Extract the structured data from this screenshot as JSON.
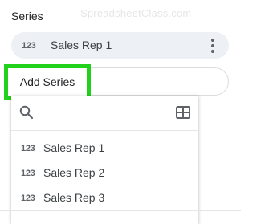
{
  "panel": {
    "section_title": "Series",
    "watermark": "SpreadsheetClass.com"
  },
  "series_chip": {
    "icon": "123-number-icon",
    "icon_text": "123",
    "label": "Sales Rep 1",
    "menu_icon": "more-vert-icon"
  },
  "add_series": {
    "label": "Add Series",
    "highlight_color": "#22d11b"
  },
  "dropdown": {
    "search_icon": "search-icon",
    "grid_icon": "grid-select-range-icon",
    "items": [
      {
        "icon_text": "123",
        "label": "Sales Rep 1"
      },
      {
        "icon_text": "123",
        "label": "Sales Rep 2"
      },
      {
        "icon_text": "123",
        "label": "Sales Rep 3"
      }
    ]
  }
}
